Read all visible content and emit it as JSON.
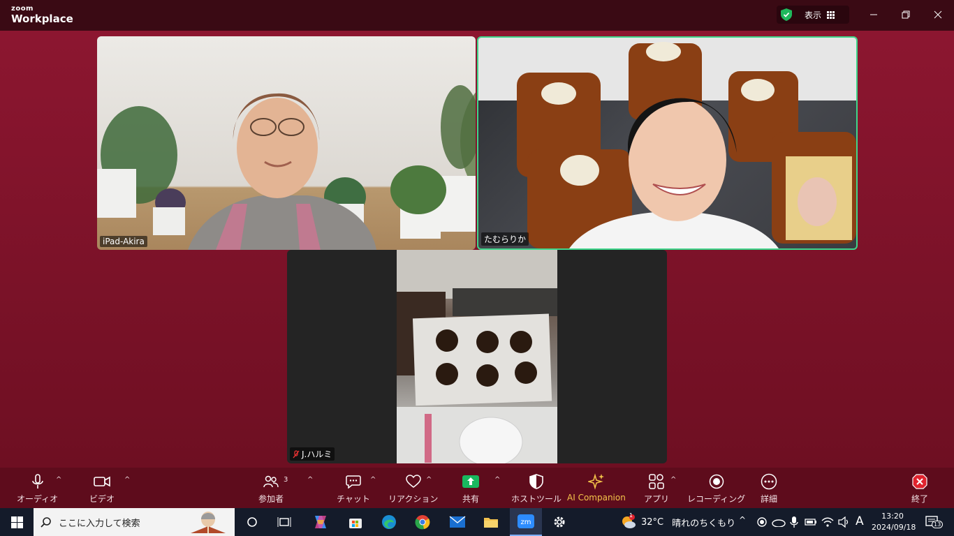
{
  "app": {
    "brand_small": "zoom",
    "brand_large": "Workplace"
  },
  "titlebar": {
    "view_label": "表示"
  },
  "participants": [
    {
      "name": "iPad-Akira"
    },
    {
      "name": "たむらりか"
    },
    {
      "name": "J.ハルミ"
    }
  ],
  "toolbar": {
    "audio": "オーディオ",
    "video": "ビデオ",
    "participants": "参加者",
    "participants_count": "3",
    "chat": "チャット",
    "reaction": "リアクション",
    "share": "共有",
    "host_tools": "ホストツール",
    "ai_companion": "AI Companion",
    "apps": "アプリ",
    "recording": "レコーディング",
    "more": "詳細",
    "end": "終了"
  },
  "taskbar": {
    "search_placeholder": "ここに入力して検索",
    "weather_temp": "32°C",
    "weather_text": "晴れのちくもり",
    "weather_badge": "1",
    "ime": "A",
    "time": "13:20",
    "date": "2024/09/18",
    "notification_count": "13"
  },
  "colors": {
    "stage": "#7a1228",
    "active_speaker": "#3fd68b",
    "share": "#19b85f",
    "end": "#e0232e"
  }
}
